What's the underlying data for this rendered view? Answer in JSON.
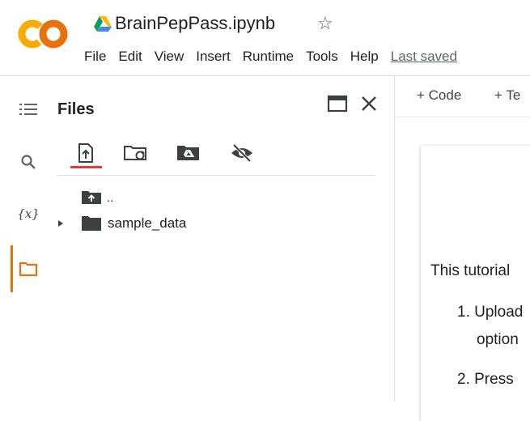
{
  "header": {
    "logo_text": "CO",
    "notebook_title": "BrainPepPass.ipynb",
    "menu": [
      "File",
      "Edit",
      "View",
      "Insert",
      "Runtime",
      "Tools",
      "Help"
    ],
    "last_saved": "Last saved"
  },
  "sidebar": {
    "rail": [
      "table-of-contents-icon",
      "search-icon",
      "variables-icon",
      "folder-icon"
    ],
    "variables_label": "{x}"
  },
  "files_panel": {
    "title": "Files",
    "toolbar": [
      "upload-icon",
      "refresh-folder-icon",
      "mount-drive-icon",
      "hide-files-icon"
    ],
    "entries": [
      {
        "name": "..",
        "type": "parent"
      },
      {
        "name": "sample_data",
        "type": "folder"
      }
    ]
  },
  "notebook": {
    "add_code": "+ Code",
    "add_text": "+ Te",
    "lines": [
      "This tutorial",
      "1. Upload",
      "option",
      "2. Press"
    ]
  },
  "colors": {
    "accent": "#e8710a",
    "upload_indicator": "#e53935",
    "logo_orange": "#f9ab00"
  }
}
